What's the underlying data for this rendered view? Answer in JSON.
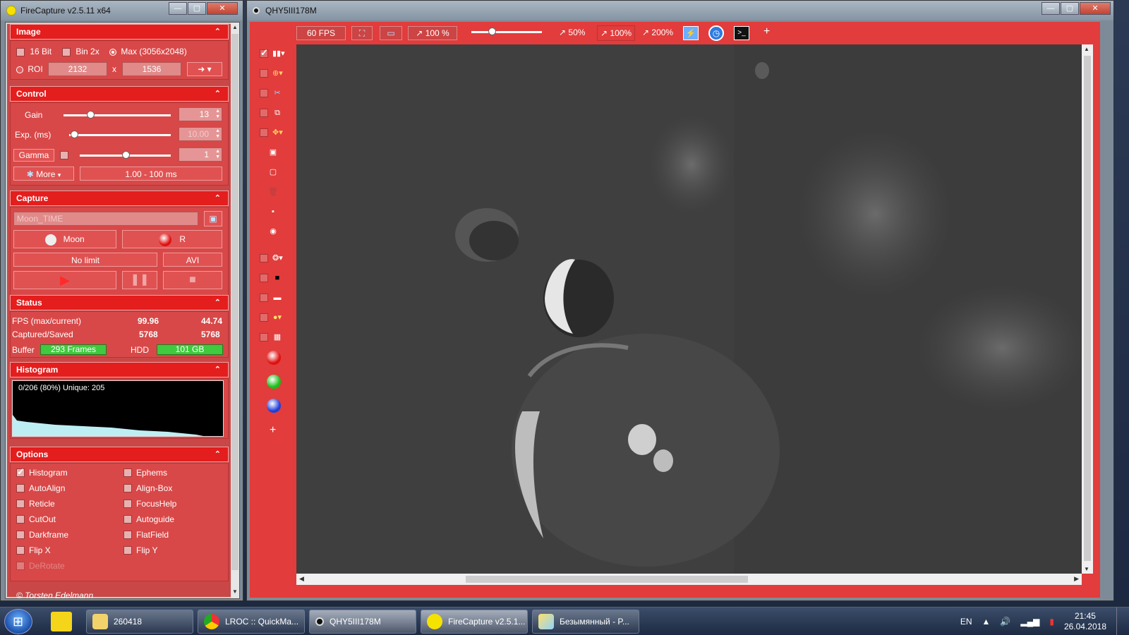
{
  "left_window": {
    "title": "FireCapture v2.5.11  x64",
    "copyright": "© Torsten Edelmann",
    "image": {
      "header": "Image",
      "bit16_label": "16 Bit",
      "bin_label": "Bin 2x",
      "max_label": "Max (3056x2048)",
      "roi_label": "ROI",
      "roi_width": "2132",
      "roi_x": "x",
      "roi_height": "1536"
    },
    "control": {
      "header": "Control",
      "gain_label": "Gain",
      "gain_value": "13",
      "gain_level": 0.25,
      "exp_label": "Exp. (ms)",
      "exp_value": "10.00",
      "exp_level": 0.05,
      "gamma_label": "Gamma",
      "gamma_value": "1",
      "gamma_level": 0.5,
      "more_label": "More",
      "range_label": "1.00 - 100 ms"
    },
    "capture": {
      "header": "Capture",
      "filename_placeholder": "Moon_TIME",
      "profile_label": "Moon",
      "filter_label": "R",
      "limit_label": "No limit",
      "format_label": "AVI"
    },
    "status": {
      "header": "Status",
      "fps_label": "FPS (max/current)",
      "fps_max": "99.96",
      "fps_current": "44.74",
      "captured_label": "Captured/Saved",
      "captured": "5768",
      "saved": "5768",
      "buffer_label": "Buffer",
      "buffer_value": "293 Frames",
      "hdd_label": "HDD",
      "hdd_value": "101 GB"
    },
    "histogram": {
      "header": "Histogram",
      "info": "0/206 (80%)  Unique: 205"
    },
    "options": {
      "header": "Options",
      "left": [
        {
          "label": "Histogram",
          "checked": true
        },
        {
          "label": "AutoAlign",
          "checked": false
        },
        {
          "label": "Reticle",
          "checked": false
        },
        {
          "label": "CutOut",
          "checked": false
        },
        {
          "label": "Darkframe",
          "checked": false
        },
        {
          "label": "Flip X",
          "checked": false
        },
        {
          "label": "DeRotate",
          "checked": false,
          "disabled": true
        }
      ],
      "right": [
        {
          "label": "Ephems",
          "checked": false
        },
        {
          "label": "Align-Box",
          "checked": false
        },
        {
          "label": "FocusHelp",
          "checked": false
        },
        {
          "label": "Autoguide",
          "checked": false
        },
        {
          "label": "FlatField",
          "checked": false
        },
        {
          "label": "Flip Y",
          "checked": false
        }
      ]
    }
  },
  "right_window": {
    "title": "QHY5III178M",
    "toolbar": {
      "fps_label": "60 FPS",
      "zoom_label": "100 %",
      "zoom_50": "50%",
      "zoom_100": "100%",
      "zoom_200": "200%",
      "plus": "+"
    },
    "side_plus": "+"
  },
  "taskbar": {
    "items": [
      {
        "label": "260418"
      },
      {
        "label": "LROC :: QuickMa..."
      },
      {
        "label": "QHY5III178M"
      },
      {
        "label": "FireCapture v2.5.1..."
      },
      {
        "label": "Безымянный - P..."
      }
    ],
    "lang": "EN",
    "time": "21:45",
    "date": "26.04.2018"
  },
  "colors": {
    "accent_red": "#e23c3c",
    "header_red": "#e41d1d",
    "status_green": "#3fca3f"
  }
}
